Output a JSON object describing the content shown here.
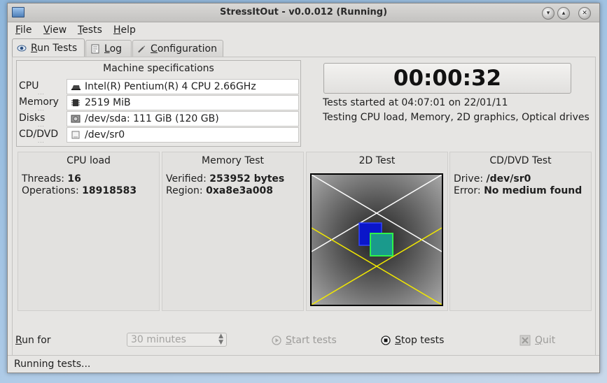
{
  "window": {
    "title": "StressItOut - v0.0.012 (Running)"
  },
  "menu": {
    "file": {
      "prefix": "",
      "accel": "F",
      "rest": "ile"
    },
    "view": {
      "prefix": "",
      "accel": "V",
      "rest": "iew"
    },
    "tests": {
      "prefix": "",
      "accel": "T",
      "rest": "ests"
    },
    "help": {
      "prefix": "",
      "accel": "H",
      "rest": "elp"
    }
  },
  "tabs": {
    "run_tests": {
      "accel": "R",
      "rest": "un Tests",
      "icon": "eye-icon"
    },
    "log": {
      "accel": "L",
      "rest": "og",
      "icon": "document-icon"
    },
    "configuration": {
      "accel": "C",
      "rest": "onfiguration",
      "icon": "wrench-icon"
    }
  },
  "specs": {
    "title": "Machine specifications",
    "rows": [
      {
        "label": "CPU",
        "value": "Intel(R) Pentium(R) 4 CPU 2.66GHz",
        "icon": "cpu-icon"
      },
      {
        "label": "Memory",
        "value": "2519 MiB",
        "icon": "memory-chip-icon"
      },
      {
        "label": "Disks",
        "value": "/dev/sda: 111 GiB (120 GB)",
        "icon": "harddisk-icon"
      },
      {
        "label": "CD/DVD",
        "value": "/dev/sr0",
        "icon": "optical-drive-icon"
      }
    ]
  },
  "timer": "00:00:32",
  "status_lines": {
    "started": "Tests started at 04:07:01 on 22/01/11",
    "testing": "Testing CPU load, Memory, 2D graphics, Optical drives"
  },
  "panels": {
    "cpu": {
      "title": "CPU load",
      "threads_label": "Threads:",
      "threads_value": "16",
      "operations_label": "Operations:",
      "operations_value": "18918583"
    },
    "memory": {
      "title": "Memory Test",
      "verified_label": "Verified:",
      "verified_value": "253952 bytes",
      "region_label": "Region:",
      "region_value": "0xa8e3a008"
    },
    "test2d": {
      "title": "2D Test"
    },
    "cddvd": {
      "title": "CD/DVD Test",
      "drive_label": "Drive:",
      "drive_value": "/dev/sr0",
      "error_label": "Error:",
      "error_value": "No medium found"
    }
  },
  "bottom": {
    "run_for": {
      "accel": "R",
      "rest": "un for"
    },
    "duration_value": "30 minutes",
    "start": {
      "accel": "S",
      "rest": "tart tests",
      "enabled": false,
      "icon": "play-icon"
    },
    "stop": {
      "accel": "S",
      "rest": "top tests",
      "enabled": true,
      "icon": "stop-icon"
    },
    "quit": {
      "accel": "Q",
      "rest": "uit",
      "enabled": false,
      "icon": "close-icon"
    }
  },
  "statusbar": "Running tests...",
  "colors": {
    "blue_square": "#0a16c9",
    "teal_square": "#1a9a8c",
    "yellow_line": "#f2e800",
    "white_line": "#ffffff"
  }
}
